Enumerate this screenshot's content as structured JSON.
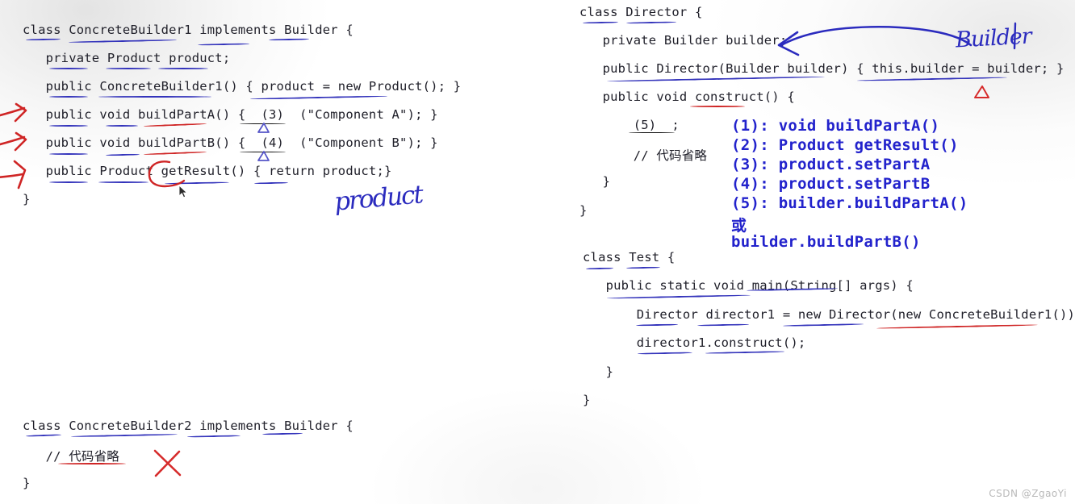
{
  "watermark": "CSDN @ZgaoYi",
  "left_panel": {
    "builder1": {
      "lines": [
        "class ConcreteBuilder1 implements Builder {",
        "   private Product product;",
        "   public ConcreteBuilder1() { product = new Product(); }",
        "   public void buildPartA() {  (3)  (\"Component A\"); }",
        "   public void buildPartB() {  (4)  (\"Component B\"); }",
        "   public Product getResult() { return product;}",
        "}"
      ]
    },
    "builder2": {
      "lines": [
        "class ConcreteBuilder2 implements Builder {",
        "   // 代码省略",
        "}"
      ]
    },
    "handwriting": {
      "product_note": "product"
    }
  },
  "right_panel": {
    "director": {
      "lines": [
        "class Director {",
        "   private Builder builder;",
        "   public Director(Builder builder) { this.builder = builder; }",
        "   public void construct() {",
        "       (5)  ;",
        "       // 代码省略",
        "   }",
        "}"
      ]
    },
    "test": {
      "lines": [
        "class Test {",
        "   public static void main(String[] args) {",
        "       Director director1 = new Director(new ConcreteBuilder1());",
        "       director1.construct();",
        "   }",
        "}"
      ]
    },
    "handwriting": {
      "builder_note": "Builder"
    },
    "answers": {
      "items": [
        "(1): void buildPartA()",
        "(2): Product getResult()",
        "(3): product.setPartA",
        "(4): product.setPartB",
        "(5): builder.buildPartA()",
        "或",
        "builder.buildPartB()"
      ]
    }
  },
  "colors": {
    "blue_ink": "#3333bb",
    "red_ink": "#cf2525",
    "answer_blue": "#2222cc",
    "code_text": "#20202a"
  }
}
